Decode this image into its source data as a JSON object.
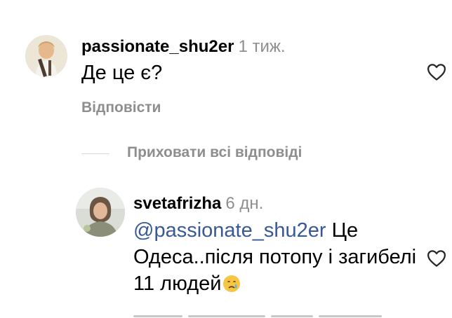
{
  "comments": [
    {
      "username": "passionate_shu2er",
      "time": "1 тиж.",
      "text": "Де це є?",
      "reply_label": "Відповісти"
    }
  ],
  "hide_replies_label": "Приховати всі відповіді",
  "reply": {
    "username": "svetafrizha",
    "time": "6 дн.",
    "mention": "@passionate_shu2er",
    "text": " Це Одеса..після потопу і загибелі 11 людей"
  },
  "icons": {
    "like": "heart-outline-icon",
    "emoji": "crying-face-emoji"
  },
  "colors": {
    "mention": "#385898",
    "muted": "#8e8e8e",
    "divider": "#dbdbdb"
  }
}
